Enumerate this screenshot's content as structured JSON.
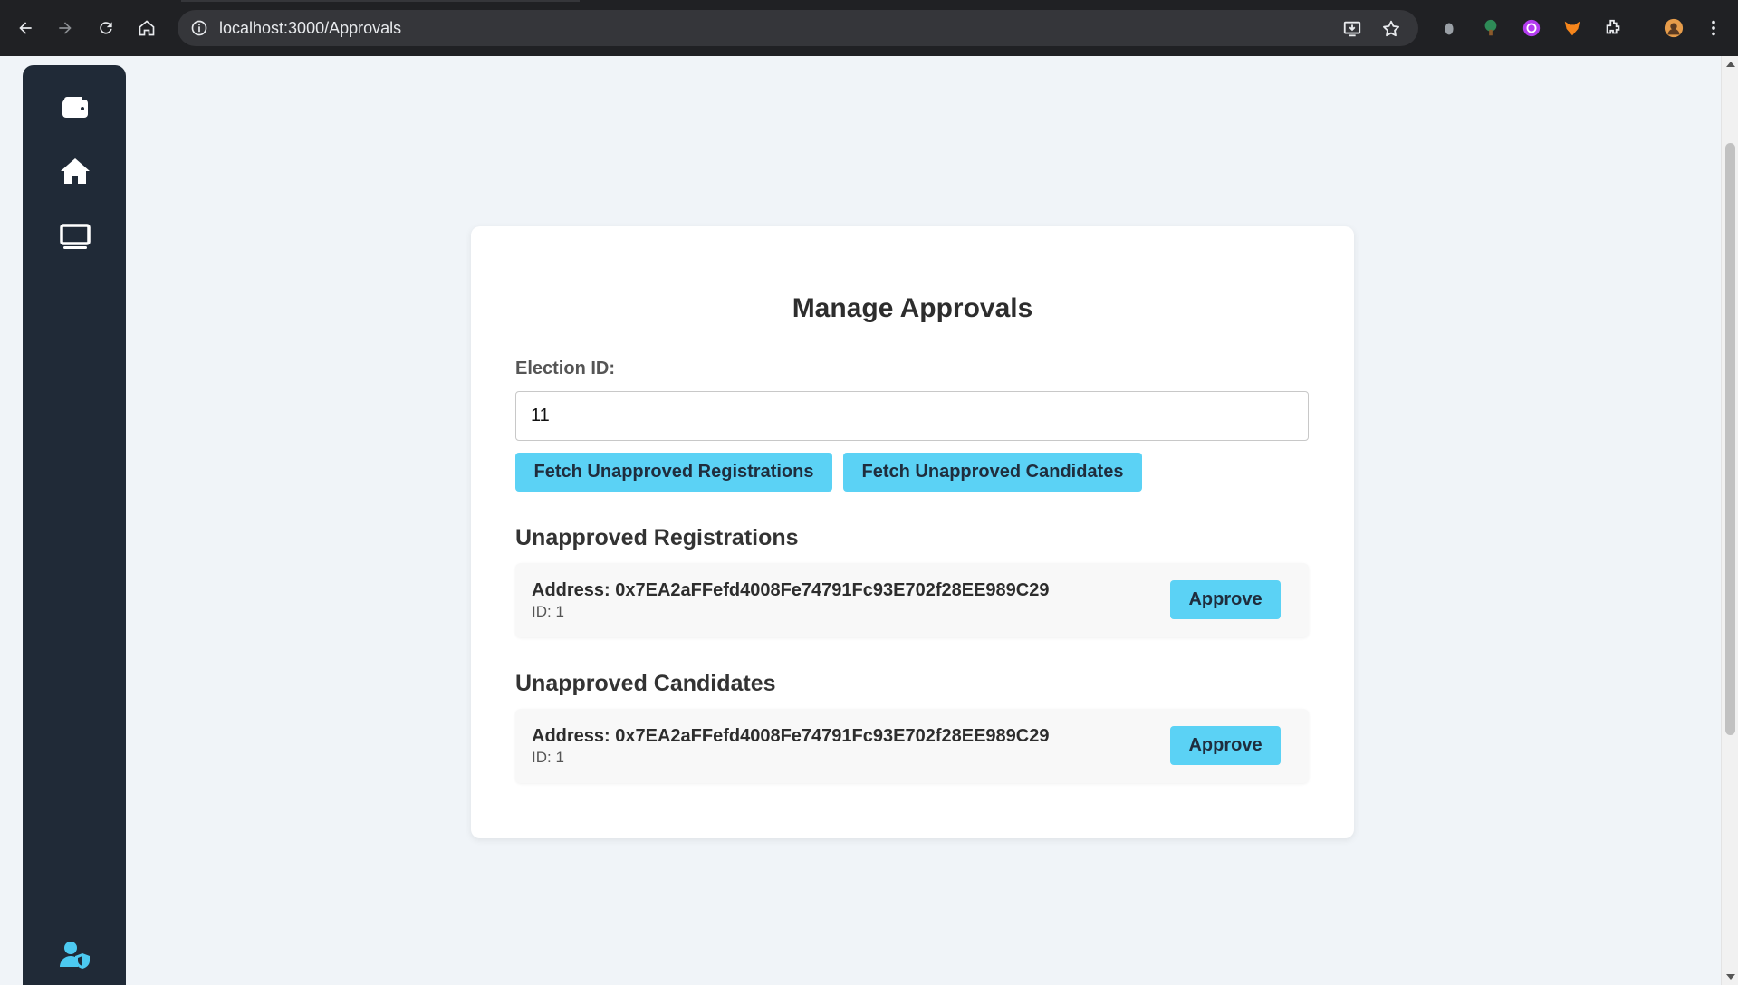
{
  "browser": {
    "url": "localhost:3000/Approvals"
  },
  "colors": {
    "chrome_bg": "#202124",
    "omnibox_bg": "#35363a",
    "sidebar_bg": "#202a37",
    "page_bg": "#f0f4f8",
    "accent": "#5bd2f5",
    "accent_icon": "#4cc9f0"
  },
  "sidebar": {
    "icons": [
      "wallet-icon",
      "home-icon",
      "monitor-icon",
      "user-shield-icon"
    ]
  },
  "approvals": {
    "title": "Manage Approvals",
    "election_label": "Election ID:",
    "election_value": "11",
    "fetch_registrations_label": "Fetch Unapproved Registrations",
    "fetch_candidates_label": "Fetch Unapproved Candidates",
    "registrations": {
      "heading": "Unapproved Registrations",
      "items": [
        {
          "address": "Address: 0x7EA2aFFefd4008Fe74791Fc93E702f28EE989C29",
          "id": "ID: 1",
          "action": "Approve"
        }
      ]
    },
    "candidates": {
      "heading": "Unapproved Candidates",
      "items": [
        {
          "address": "Address: 0x7EA2aFFefd4008Fe74791Fc93E702f28EE989C29",
          "id": "ID: 1",
          "action": "Approve"
        }
      ]
    }
  }
}
